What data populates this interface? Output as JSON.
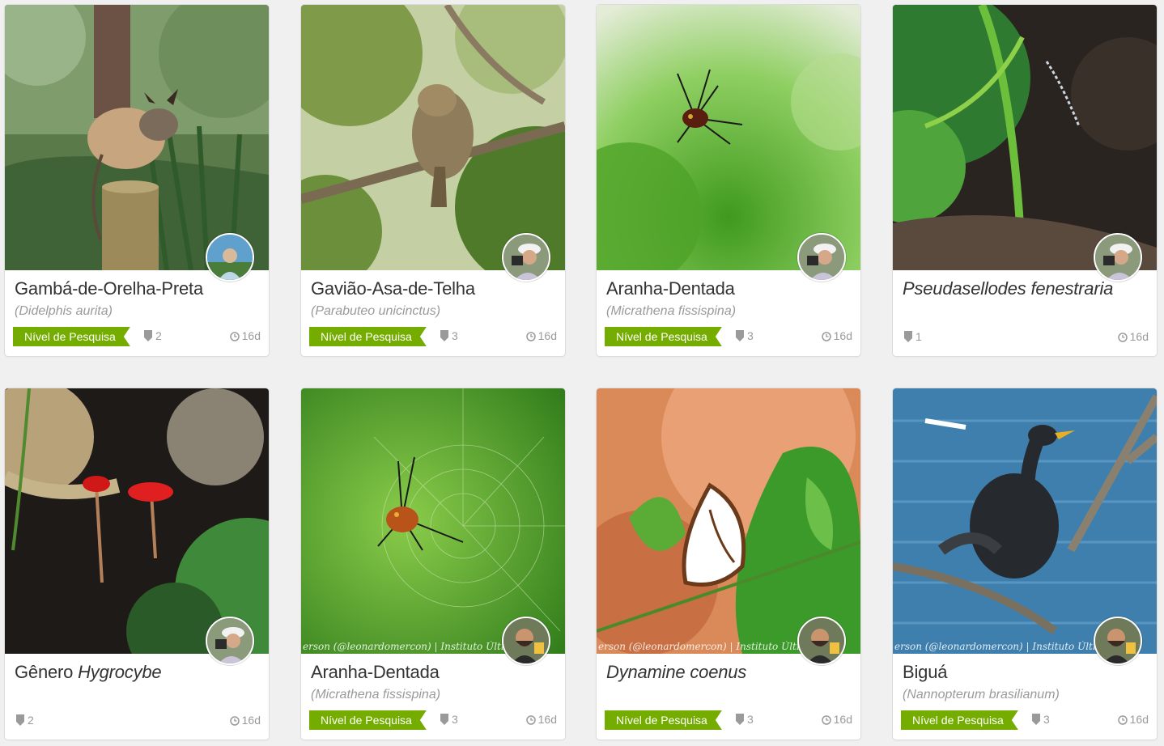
{
  "cards": [
    {
      "common_name": "Gambá-de-Orelha-Preta",
      "scientific_name": "(Didelphis aurita)",
      "quality_grade": "Nível de Pesquisa",
      "identifications": "2",
      "age": "16d",
      "photo_subject": "opossum",
      "avatar_subject": "user-older-man"
    },
    {
      "common_name": "Gavião-Asa-de-Telha",
      "scientific_name": "(Parabuteo unicinctus)",
      "quality_grade": "Nível de Pesquisa",
      "identifications": "3",
      "age": "16d",
      "photo_subject": "hawk",
      "avatar_subject": "user-photographer-cap"
    },
    {
      "common_name": "Aranha-Dentada",
      "scientific_name": "(Micrathena fissispina)",
      "quality_grade": "Nível de Pesquisa",
      "identifications": "3",
      "age": "16d",
      "photo_subject": "spider",
      "avatar_subject": "user-photographer-cap"
    },
    {
      "common_name": "",
      "title_italic": "Pseudasellodes fenestraria",
      "scientific_name": "",
      "quality_grade": "",
      "identifications": "1",
      "age": "16d",
      "photo_subject": "caterpillar",
      "avatar_subject": "user-photographer-cap"
    },
    {
      "common_name": "Gênero ",
      "title_italic": "Hygrocybe",
      "scientific_name": "",
      "quality_grade": "",
      "identifications": "2",
      "age": "16d",
      "photo_subject": "mushroom",
      "avatar_subject": "user-photographer-cap"
    },
    {
      "common_name": "Aranha-Dentada",
      "scientific_name": "(Micrathena fissispina)",
      "quality_grade": "Nível de Pesquisa",
      "identifications": "3",
      "age": "16d",
      "photo_subject": "spider-web",
      "avatar_subject": "user-bearded-man",
      "watermark": "erson (@leonardomercon) | Instituto Últimos"
    },
    {
      "common_name": "",
      "title_italic": "Dynamine coenus",
      "scientific_name": "",
      "quality_grade": "Nível de Pesquisa",
      "identifications": "3",
      "age": "16d",
      "photo_subject": "butterfly",
      "avatar_subject": "user-bearded-man",
      "watermark": "erson (@leonardomercon) | Instituto Últimos"
    },
    {
      "common_name": "Biguá",
      "scientific_name": "(Nannopterum brasilianum)",
      "quality_grade": "Nível de Pesquisa",
      "identifications": "3",
      "age": "16d",
      "photo_subject": "cormorant",
      "avatar_subject": "user-bearded-man",
      "watermark": "erson (@leonardomercon) | Instituto Últimos"
    }
  ],
  "colors": {
    "research_grade_green": "#74ac00",
    "muted_text": "#9a9a9a",
    "title_text": "#333333"
  }
}
